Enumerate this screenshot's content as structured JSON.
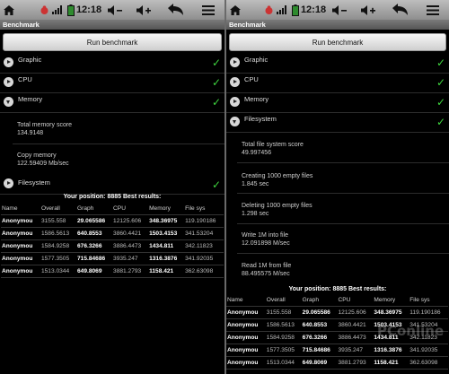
{
  "status": {
    "time": "12:18"
  },
  "app": {
    "title": "Benchmark",
    "run_label": "Run benchmark"
  },
  "left": {
    "sections": [
      {
        "label": "Graphic",
        "expanded": false
      },
      {
        "label": "CPU",
        "expanded": false
      },
      {
        "label": "Memory",
        "expanded": true
      },
      {
        "label": "Filesystem",
        "expanded": false
      }
    ],
    "memory_details": [
      {
        "label": "Total memory score",
        "value": "134.9148"
      },
      {
        "label": "Copy memory",
        "value": "122.59409 Mb/sec"
      }
    ]
  },
  "right": {
    "sections": [
      {
        "label": "Graphic",
        "expanded": false
      },
      {
        "label": "CPU",
        "expanded": false
      },
      {
        "label": "Memory",
        "expanded": false
      },
      {
        "label": "Filesystem",
        "expanded": true
      }
    ],
    "fs_details": [
      {
        "label": "Total file system score",
        "value": "49.997456"
      },
      {
        "label": "Creating 1000 empty files",
        "value": "1.845 sec"
      },
      {
        "label": "Deleting 1000 empty files",
        "value": "1.298 sec"
      },
      {
        "label": "Write 1M into file",
        "value": "12.091898 M/sec"
      },
      {
        "label": "Read 1M from file",
        "value": "88.495575 M/sec"
      }
    ]
  },
  "results": {
    "heading": "Your position: 8885 Best results:",
    "columns": [
      "Name",
      "Overall",
      "Graph",
      "CPU",
      "Memory",
      "File sys"
    ],
    "rows": [
      [
        "Anonymou",
        "3155.558",
        "29.065586",
        "12125.606",
        "348.36975",
        "119.190186"
      ],
      [
        "Anonymou",
        "1586.5613",
        "640.8553",
        "3860.4421",
        "1503.4153",
        "341.53204"
      ],
      [
        "Anonymou",
        "1584.9258",
        "676.3266",
        "3886.4473",
        "1434.811",
        "342.11823"
      ],
      [
        "Anonymou",
        "1577.3505",
        "715.84686",
        "3935.247",
        "1316.3876",
        "341.92035"
      ],
      [
        "Anonymou",
        "1513.0344",
        "649.8069",
        "3881.2793",
        "1158.421",
        "362.63098"
      ]
    ]
  },
  "watermark": {
    "text": "PConline"
  },
  "colors": {
    "check": "#3fd43f",
    "statusbar": "#a8a8a8"
  }
}
